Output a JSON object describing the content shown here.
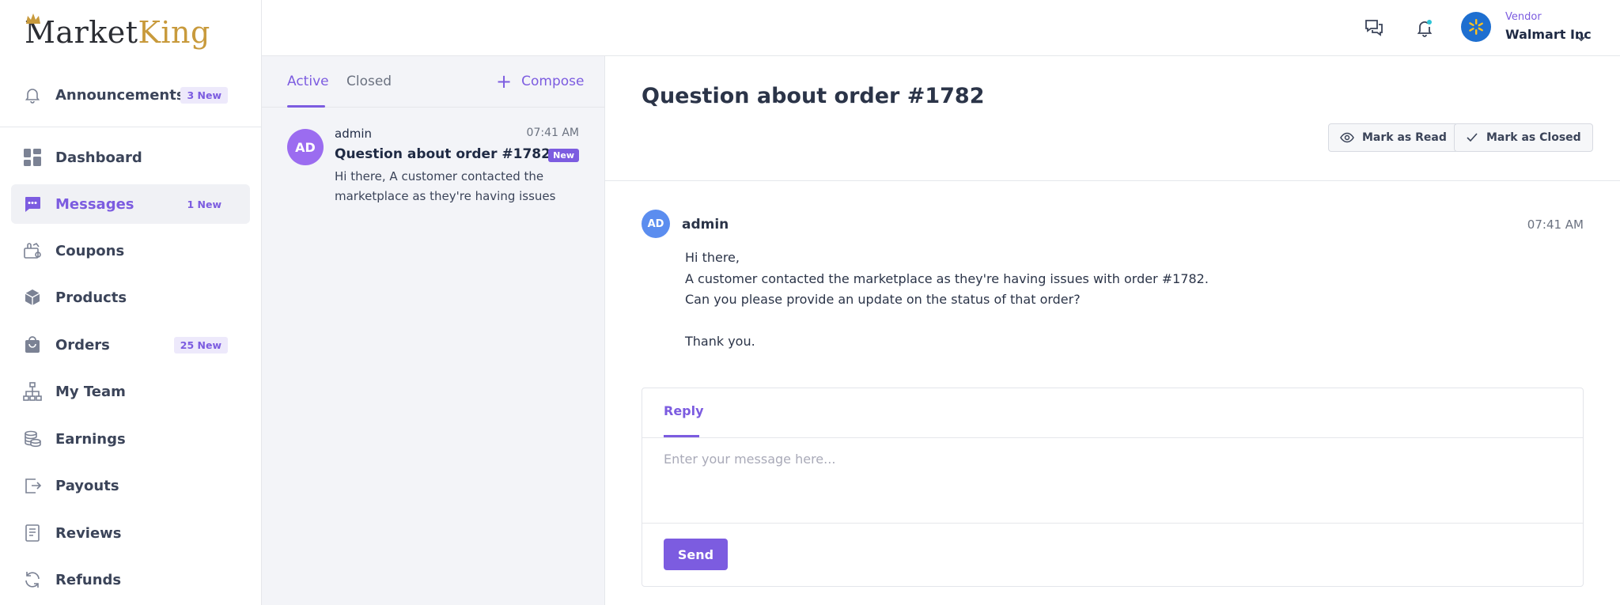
{
  "brand": {
    "logo_text_part1": "Market",
    "logo_text_part2": "King",
    "gold": "#c89a3c"
  },
  "sidebar": {
    "items": [
      {
        "label": "Announcements",
        "badge": "3 New",
        "icon": "bell-icon"
      },
      {
        "label": "Dashboard",
        "badge": "",
        "icon": "dashboard-grid-icon"
      },
      {
        "label": "Messages",
        "badge": "1 New",
        "icon": "chat-bubble-icon",
        "active": true
      },
      {
        "label": "Coupons",
        "badge": "",
        "icon": "coupon-icon"
      },
      {
        "label": "Products",
        "badge": "",
        "icon": "box-icon"
      },
      {
        "label": "Orders",
        "badge": "25 New",
        "icon": "shopping-bag-icon"
      },
      {
        "label": "My Team",
        "badge": "",
        "icon": "org-chart-icon"
      },
      {
        "label": "Earnings",
        "badge": "",
        "icon": "coins-icon"
      },
      {
        "label": "Payouts",
        "badge": "",
        "icon": "payout-icon"
      },
      {
        "label": "Reviews",
        "badge": "",
        "icon": "review-icon"
      },
      {
        "label": "Refunds",
        "badge": "",
        "icon": "refresh-icon"
      }
    ]
  },
  "topbar": {
    "vendor_role": "Vendor",
    "vendor_name": "Walmart Inc"
  },
  "message_list": {
    "tabs": [
      {
        "label": "Active",
        "active": true
      },
      {
        "label": "Closed",
        "active": false
      }
    ],
    "compose_label": "Compose",
    "threads": [
      {
        "avatar": "AD",
        "sender": "admin",
        "time": "07:41 AM",
        "subject": "Question about order #1782",
        "badge": "New",
        "preview": "Hi there, A customer contacted the marketplace as they're having issues"
      }
    ]
  },
  "detail": {
    "title": "Question about order #1782",
    "mark_read_label": "Mark as Read",
    "mark_closed_label": "Mark as Closed",
    "message": {
      "avatar": "AD",
      "sender": "admin",
      "time": "07:41 AM",
      "lines": [
        "Hi there,",
        "A customer contacted the marketplace as they're having issues with order #1782.",
        "Can you please provide an update on the status of that order?",
        "",
        "Thank you."
      ]
    },
    "reply": {
      "tab_label": "Reply",
      "placeholder": "Enter your message here...",
      "value": "",
      "send_label": "Send"
    }
  },
  "colors": {
    "accent": "#7c5ce0",
    "sidebar_active_bg": "#f0f1f5",
    "list_bg": "#f3f4f8",
    "notification_dot": "#2ec4d6",
    "vendor_avatar": "#1e6fd0"
  }
}
